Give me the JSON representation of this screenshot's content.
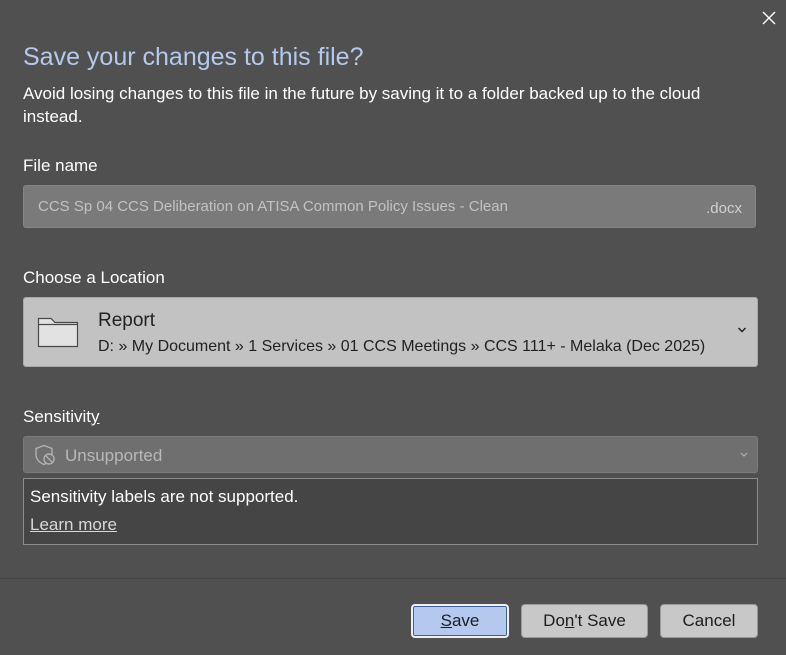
{
  "dialog": {
    "title": "Save your changes to this file?",
    "subtitle": "Avoid losing changes to this file in the future by saving it to a folder backed up to the cloud instead.",
    "close_icon": "close-icon"
  },
  "file_name": {
    "label": "File name",
    "value": "CCS Sp 04 CCS Deliberation on ATISA Common Policy Issues - Clean",
    "extension": ".docx"
  },
  "location": {
    "label": "Choose a Location",
    "folder_name": "Report",
    "path": "D: » My Document » 1 Services » 01 CCS Meetings » CCS 111+ - Melaka (Dec 2025)",
    "icon": "folder-icon"
  },
  "sensitivity": {
    "label_pre": "Sensitivit",
    "label_accel": "y",
    "selected_value": "Unsupported",
    "message": "Sensitivity labels are not supported.",
    "learn_more": "Learn more",
    "icon": "shield-blocked-icon"
  },
  "buttons": {
    "save_accel": "S",
    "save_rest": "ave",
    "dont_save_pre": "Do",
    "dont_save_accel": "n",
    "dont_save_rest": "'t Save",
    "cancel": "Cancel"
  },
  "colors": {
    "background": "#505050",
    "title": "#b4c9ec",
    "primary_button": "#b5c9ef",
    "secondary_button": "#c8c8c8"
  }
}
